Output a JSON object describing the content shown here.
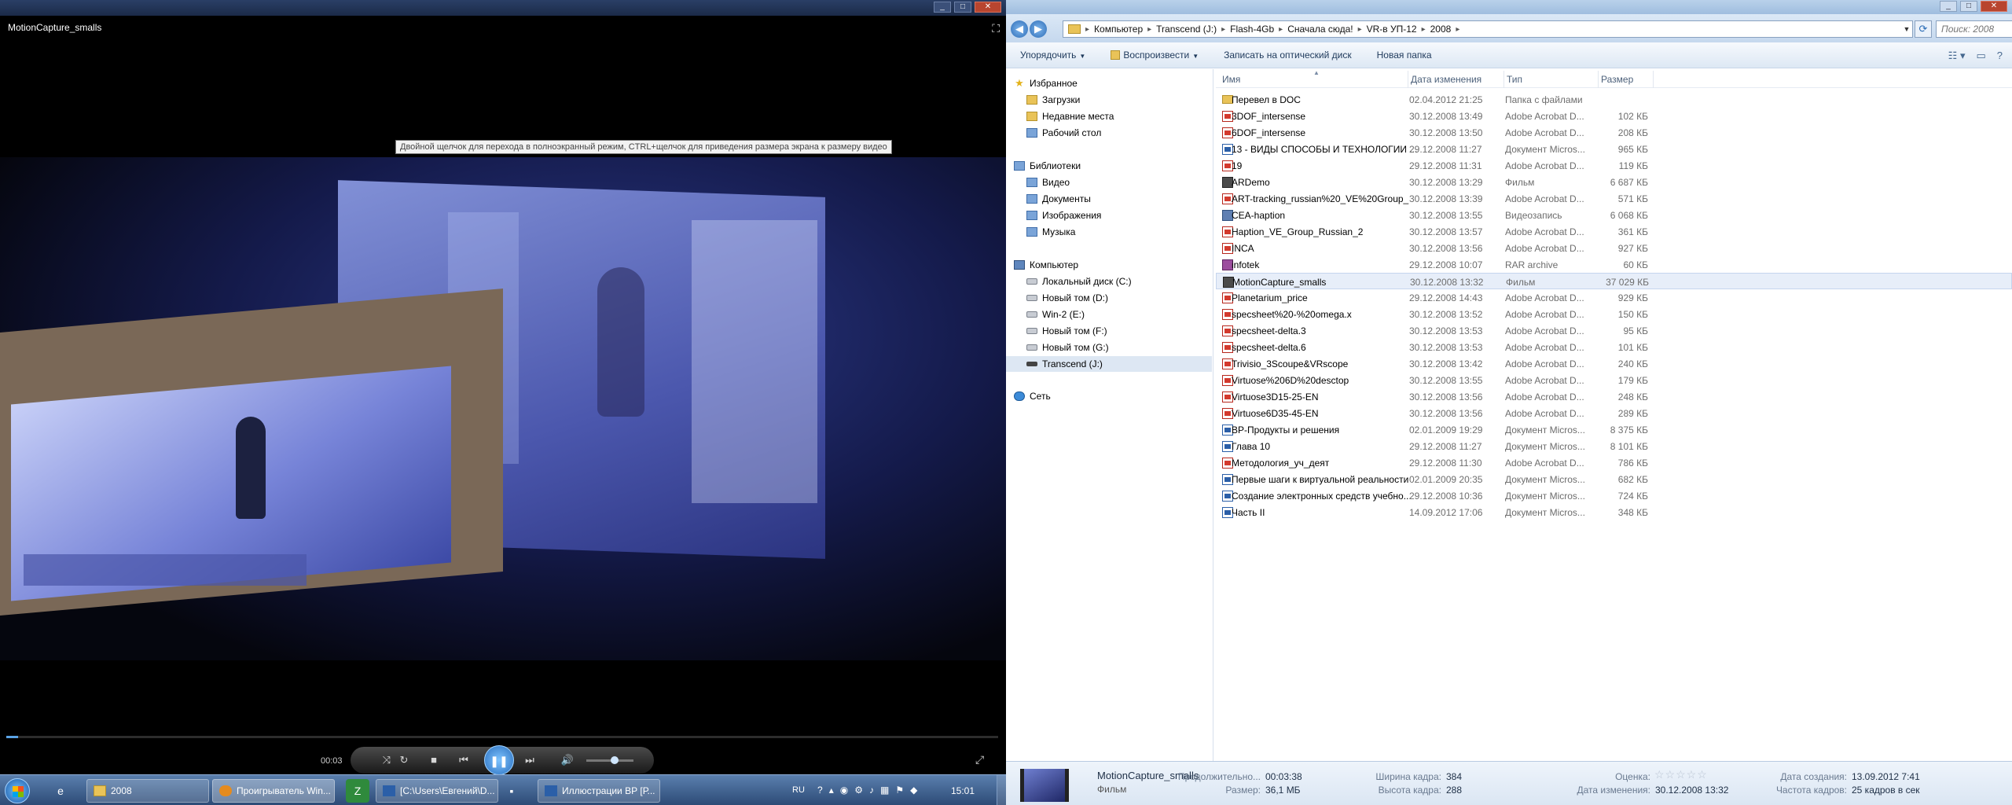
{
  "player": {
    "title": "MotionCapture_smalls",
    "tooltip": "Двойной щелчок для перехода в полноэкранный режим, CTRL+щелчок для приведения размера экрана к размеру видео",
    "elapsed": "00:03",
    "progress_fraction": 0.012,
    "volume_fraction": 0.6
  },
  "explorer": {
    "address_path": [
      "Компьютер",
      "Transcend (J:)",
      "Flash-4Gb",
      "Сначала сюда!",
      "VR-в УП-12",
      "2008"
    ],
    "search_placeholder": "Поиск: 2008",
    "toolbar": {
      "organize": "Упорядочить",
      "play": "Воспроизвести",
      "burn": "Записать на оптический диск",
      "new_folder": "Новая папка"
    },
    "nav": {
      "favorites": "Избранное",
      "downloads": "Загрузки",
      "recent": "Недавние места",
      "desktop": "Рабочий стол",
      "libraries": "Библиотеки",
      "video": "Видео",
      "documents": "Документы",
      "images": "Изображения",
      "music": "Музыка",
      "computer": "Компьютер",
      "drive_c": "Локальный диск (C:)",
      "drive_d": "Новый том (D:)",
      "drive_e": "Win-2 (E:)",
      "drive_f": "Новый том (F:)",
      "drive_g": "Новый том (G:)",
      "drive_j": "Transcend (J:)",
      "network": "Сеть"
    },
    "columns": {
      "name": "Имя",
      "date": "Дата изменения",
      "type": "Тип",
      "size": "Размер"
    },
    "files": [
      {
        "icon": "folder",
        "name": "Перевел в DOC",
        "date": "02.04.2012 21:25",
        "type": "Папка с файлами",
        "size": ""
      },
      {
        "icon": "pdf",
        "name": "3DOF_intersense",
        "date": "30.12.2008 13:49",
        "type": "Adobe Acrobat D...",
        "size": "102 КБ"
      },
      {
        "icon": "pdf",
        "name": "6DOF_intersense",
        "date": "30.12.2008 13:50",
        "type": "Adobe Acrobat D...",
        "size": "208 КБ"
      },
      {
        "icon": "doc",
        "name": "13 - ВИДЫ СПОСОБЫ И ТЕХНОЛОГИИ ...",
        "date": "29.12.2008 11:27",
        "type": "Документ Micros...",
        "size": "965 КБ"
      },
      {
        "icon": "pdf",
        "name": "19",
        "date": "29.12.2008 11:31",
        "type": "Adobe Acrobat D...",
        "size": "119 КБ"
      },
      {
        "icon": "film",
        "name": "ARDemo",
        "date": "30.12.2008 13:29",
        "type": "Фильм",
        "size": "6 687 КБ"
      },
      {
        "icon": "pdf",
        "name": "ART-tracking_russian%20_VE%20Group_",
        "date": "30.12.2008 13:39",
        "type": "Adobe Acrobat D...",
        "size": "571 КБ"
      },
      {
        "icon": "video",
        "name": "CEA-haption",
        "date": "30.12.2008 13:55",
        "type": "Видеозапись",
        "size": "6 068 КБ"
      },
      {
        "icon": "pdf",
        "name": "Haption_VE_Group_Russian_2",
        "date": "30.12.2008 13:57",
        "type": "Adobe Acrobat D...",
        "size": "361 КБ"
      },
      {
        "icon": "pdf",
        "name": "INCA",
        "date": "30.12.2008 13:56",
        "type": "Adobe Acrobat D...",
        "size": "927 КБ"
      },
      {
        "icon": "rar",
        "name": "infotek",
        "date": "29.12.2008 10:07",
        "type": "RAR archive",
        "size": "60 КБ"
      },
      {
        "icon": "film",
        "name": "MotionCapture_smalls",
        "date": "30.12.2008 13:32",
        "type": "Фильм",
        "size": "37 029 КБ",
        "selected": true
      },
      {
        "icon": "pdf",
        "name": "Planetarium_price",
        "date": "29.12.2008 14:43",
        "type": "Adobe Acrobat D...",
        "size": "929 КБ"
      },
      {
        "icon": "pdf",
        "name": "specsheet%20-%20omega.x",
        "date": "30.12.2008 13:52",
        "type": "Adobe Acrobat D...",
        "size": "150 КБ"
      },
      {
        "icon": "pdf",
        "name": "specsheet-delta.3",
        "date": "30.12.2008 13:53",
        "type": "Adobe Acrobat D...",
        "size": "95 КБ"
      },
      {
        "icon": "pdf",
        "name": "specsheet-delta.6",
        "date": "30.12.2008 13:53",
        "type": "Adobe Acrobat D...",
        "size": "101 КБ"
      },
      {
        "icon": "pdf",
        "name": "Trivisio_3Scoupe&VRscope",
        "date": "30.12.2008 13:42",
        "type": "Adobe Acrobat D...",
        "size": "240 КБ"
      },
      {
        "icon": "pdf",
        "name": "Virtuose%206D%20desctop",
        "date": "30.12.2008 13:55",
        "type": "Adobe Acrobat D...",
        "size": "179 КБ"
      },
      {
        "icon": "pdf",
        "name": "Virtuose3D15-25-EN",
        "date": "30.12.2008 13:56",
        "type": "Adobe Acrobat D...",
        "size": "248 КБ"
      },
      {
        "icon": "pdf",
        "name": "Virtuose6D35-45-EN",
        "date": "30.12.2008 13:56",
        "type": "Adobe Acrobat D...",
        "size": "289 КБ"
      },
      {
        "icon": "doc",
        "name": "ВР-Продукты и решения",
        "date": "02.01.2009 19:29",
        "type": "Документ Micros...",
        "size": "8 375 КБ"
      },
      {
        "icon": "doc",
        "name": "Глава 10",
        "date": "29.12.2008 11:27",
        "type": "Документ Micros...",
        "size": "8 101 КБ"
      },
      {
        "icon": "pdf",
        "name": "Методология_уч_деят",
        "date": "29.12.2008 11:30",
        "type": "Adobe Acrobat D...",
        "size": "786 КБ"
      },
      {
        "icon": "doc",
        "name": "Первые шаги к виртуальной реальности",
        "date": "02.01.2009 20:35",
        "type": "Документ Micros...",
        "size": "682 КБ"
      },
      {
        "icon": "doc",
        "name": "Создание электронных средств учебно...",
        "date": "29.12.2008 10:36",
        "type": "Документ Micros...",
        "size": "724 КБ"
      },
      {
        "icon": "doc",
        "name": "Часть II",
        "date": "14.09.2012 17:06",
        "type": "Документ Micros...",
        "size": "348 КБ"
      }
    ],
    "details": {
      "name": "MotionCapture_smalls",
      "type": "Фильм",
      "duration_label": "Продолжительно...",
      "duration_value": "00:03:38",
      "size_label": "Размер:",
      "size_value": "36,1 МБ",
      "width_label": "Ширина кадра:",
      "width_value": "384",
      "height_label": "Высота кадра:",
      "height_value": "288",
      "rating_label": "Оценка:",
      "rating_stars": "☆☆☆☆☆",
      "rating_value": 0,
      "modified_label": "Дата изменения:",
      "modified_value": "30.12.2008 13:32",
      "created_label": "Дата создания:",
      "created_value": "13.09.2012 7:41",
      "framerate_label": "Частота кадров:",
      "framerate_value": "25 кадров в сек"
    }
  },
  "taskbar": {
    "tasks": [
      "2008",
      "Проигрыватель Win...",
      "[C:\\Users\\Евгений\\D...",
      "Иллюстрации ВР [Р..."
    ],
    "language": "RU",
    "clock": "15:01"
  }
}
